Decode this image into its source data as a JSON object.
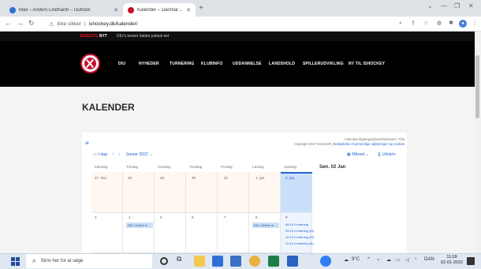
{
  "browser": {
    "tabs": [
      {
        "title": "Mail – Anders Lindhardt – Outlook",
        "active": false
      },
      {
        "title": "Kalender – Danmarks Ishockey-Union",
        "active": true
      }
    ],
    "address": {
      "security": "Ikke sikker",
      "url": "ishockey.dk/kalender/"
    }
  },
  "site": {
    "topbar": {
      "label_part1": "SENESTE",
      "label_part2": "NYT",
      "ticker": "DIU's kontor holder juleluk ket"
    },
    "menu": [
      "DIU",
      "NYHEDER",
      "TURNERING",
      "KLUBINFO",
      "UDDANNELSE",
      "LANDSHOLD",
      "SPILLERUDVIKLING",
      "NY TIL ISHOCKEY"
    ],
    "page_title": "KALENDER"
  },
  "calendar": {
    "info_line1": "Calendar-tilgængelighedsfunktioner: Tilta",
    "info_line2_prefix": "Copyright 2017 Microsoft",
    "info_line2_links": "Beskyttelse af personlige oplysninger og cookies",
    "toolbar": {
      "today": "I dag",
      "month": "Januar 2022",
      "view": "Måned",
      "print": "Udskriv"
    },
    "weekdays": [
      "Mandag",
      "Tirsdag",
      "Onsdag",
      "Torsdag",
      "Fredag",
      "Lørdag",
      "Søndag"
    ],
    "week1": [
      "27. dec.",
      "28",
      "29",
      "30",
      "31",
      "1. jan.",
      "2. jan."
    ],
    "week2": [
      "3",
      "4",
      "5",
      "6",
      "7",
      "8",
      "9"
    ],
    "agenda_date": "Søn. 02 Jan",
    "events": {
      "tue": "DIU: Online m",
      "sat": "DIU: Online m",
      "sun": [
        "08:15 U-træning",
        "09:15 U-træning (M)",
        "10:15 U-træning (M)",
        "11:15 U-træning (M)"
      ]
    }
  },
  "taskbar": {
    "search_placeholder": "Skriv her for at søge",
    "weather": "9°C",
    "lang": "DAN",
    "time": "11:09",
    "date": "02-01-2022"
  }
}
